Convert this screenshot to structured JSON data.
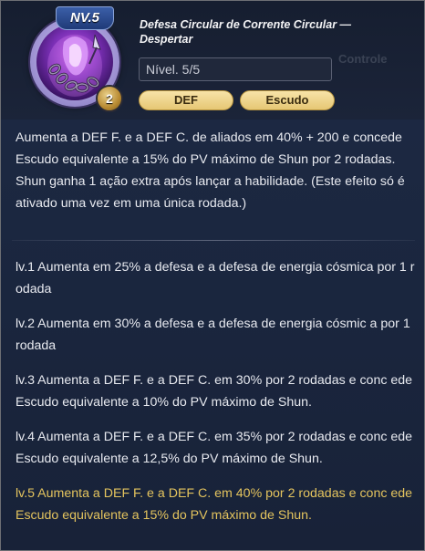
{
  "skill": {
    "level_badge": "NV.5",
    "rank": "2",
    "title": "Defesa Circular de Corrente Circular — Despertar",
    "level_field": "Nível. 5/5",
    "tags": [
      "DEF",
      "Escudo"
    ],
    "faint_label": "Controle"
  },
  "description": "Aumenta a DEF F. e a DEF C. de aliados em 40% + 200 e concede Escudo equivalente a 15% do PV máximo de Shun por 2 rodadas. Shun ganha 1 ação extra após lançar a habilidade. (Este efeito só é ativado uma vez em uma única rodada.)",
  "levels": [
    "lv.1 Aumenta em 25% a defesa e a defesa de energia cósmica por 1 rodada",
    "lv.2 Aumenta em 30% a defesa e a defesa de energia cósmic a por 1 rodada",
    "lv.3 Aumenta a DEF F. e a DEF C. em 30% por 2 rodadas e conc ede Escudo equivalente a 10% do PV máximo de Shun.",
    "lv.4 Aumenta a DEF F. e a DEF C. em 35% por 2 rodadas e conc ede Escudo equivalente a 12,5% do PV máximo de Shun.",
    "lv.5 Aumenta a DEF F. e a DEF C. em 40% por 2 rodadas e conc ede Escudo equivalente a 15% do PV máximo de Shun."
  ],
  "colors": {
    "current_level": "#e4c45e",
    "text": "#e8eaf0",
    "tag_fill": "#f0d590"
  },
  "current_level_index": 4
}
